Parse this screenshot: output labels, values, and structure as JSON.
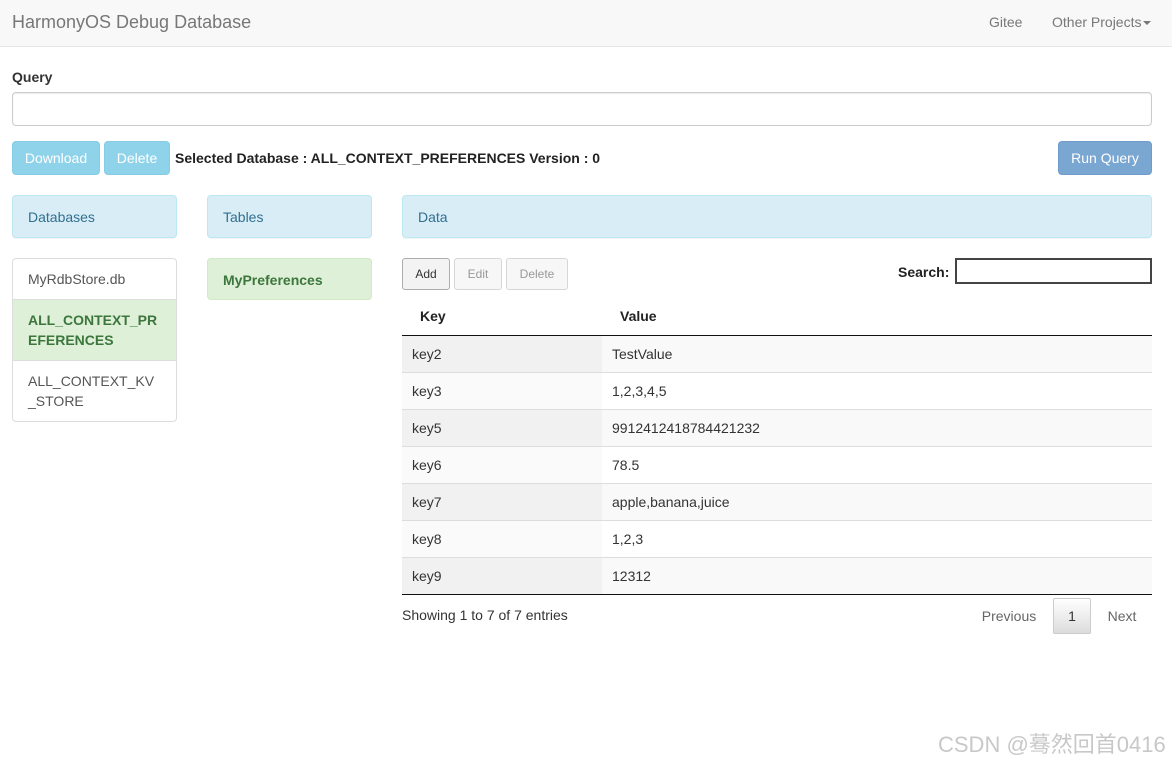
{
  "navbar": {
    "brand": "HarmonyOS Debug Database",
    "links": [
      "Gitee",
      "Other Projects"
    ]
  },
  "query": {
    "label": "Query",
    "value": "",
    "download_label": "Download",
    "delete_label": "Delete",
    "selected_db_text": "Selected Database : ALL_CONTEXT_PREFERENCES Version : 0",
    "run_label": "Run Query"
  },
  "panels": {
    "databases": "Databases",
    "tables": "Tables",
    "data": "Data"
  },
  "databases": [
    "MyRdbStore.db",
    "ALL_CONTEXT_PREFERENCES",
    "ALL_CONTEXT_KV_STORE"
  ],
  "active_database": "ALL_CONTEXT_PREFERENCES",
  "tables": [
    "MyPreferences"
  ],
  "data": {
    "buttons": {
      "add": "Add",
      "edit": "Edit",
      "delete": "Delete"
    },
    "search_label": "Search:",
    "search_value": "",
    "columns": [
      "Key",
      "Value"
    ],
    "rows": [
      [
        "key2",
        "TestValue"
      ],
      [
        "key3",
        "1,2,3,4,5"
      ],
      [
        "key5",
        "9912412418784421232"
      ],
      [
        "key6",
        "78.5"
      ],
      [
        "key7",
        "apple,banana,juice"
      ],
      [
        "key8",
        "1,2,3"
      ],
      [
        "key9",
        "12312"
      ]
    ],
    "info": "Showing 1 to 7 of 7 entries",
    "pagination": {
      "previous": "Previous",
      "page": "1",
      "next": "Next"
    }
  },
  "watermark": "CSDN @蓦然回首0416",
  "colors": {
    "panel_info_bg": "#d9edf7",
    "active_green_bg": "#dff0d8",
    "active_green_text": "#3c763d",
    "info_button": "#8fd3ea",
    "primary_button": "#7aa6d2"
  }
}
